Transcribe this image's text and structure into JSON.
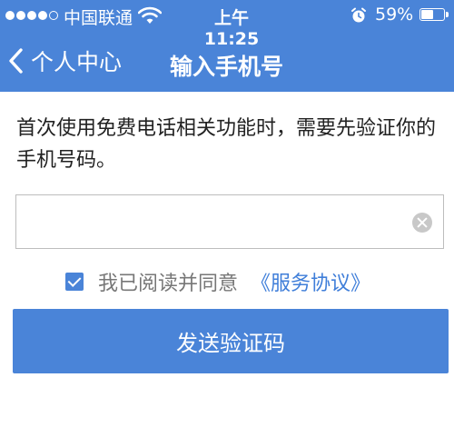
{
  "status_bar": {
    "carrier": "中国联通",
    "time": "上午11:25",
    "battery_percent_text": "59%",
    "battery_level": 0.59,
    "signal_bars_filled": 4,
    "signal_bars_total": 5
  },
  "nav": {
    "back_label": "个人中心",
    "title": "输入手机号"
  },
  "description": "首次使用免费电话相关功能时，需要先验证你的手机号码。",
  "phone_input": {
    "value": "",
    "placeholder": ""
  },
  "agreement": {
    "checked": true,
    "text": "我已阅读并同意",
    "link_text": "《服务协议》"
  },
  "send_button": {
    "label": "发送验证码"
  },
  "colors": {
    "accent": "#4a84d8",
    "link": "#3f7ed9"
  },
  "icons": {
    "back": "chevron-left-icon",
    "wifi": "wifi-icon",
    "alarm": "alarm-clock-icon",
    "battery": "battery-icon",
    "clear": "clear-circle-icon",
    "checkbox": "checkbox-checked-icon"
  }
}
